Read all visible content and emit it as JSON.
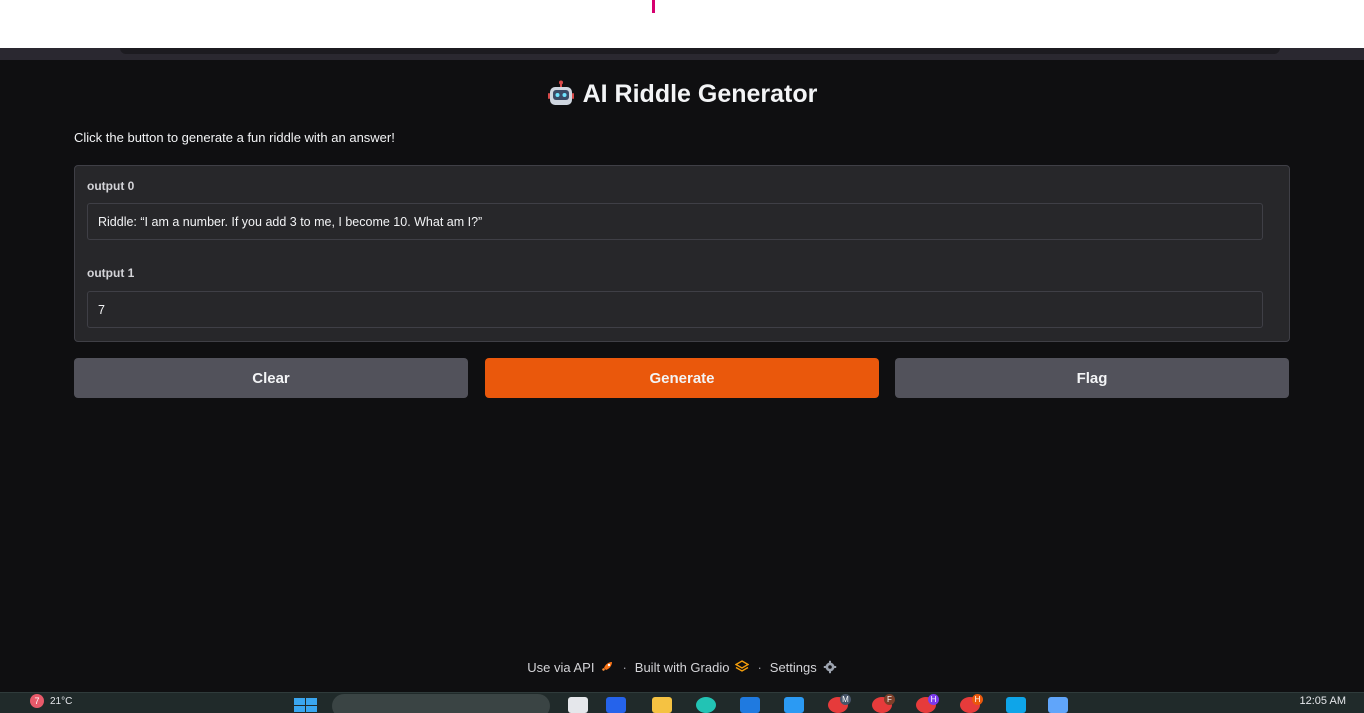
{
  "app": {
    "title": "AI Riddle Generator",
    "description": "Click the button to generate a fun riddle with an answer!"
  },
  "outputs": [
    {
      "label": "output 0",
      "value": "Riddle: “I am a number. If you add 3 to me, I become 10. What am I?”"
    },
    {
      "label": "output 1",
      "value": "7"
    }
  ],
  "buttons": {
    "clear": "Clear",
    "generate": "Generate",
    "flag": "Flag"
  },
  "footer": {
    "api": "Use via API",
    "built": "Built with Gradio",
    "settings": "Settings",
    "separator": "·"
  },
  "taskbar": {
    "weather_badge": "7",
    "temperature": "21°C",
    "clock": "12:05 AM",
    "app_badges": [
      "M",
      "F",
      "H",
      "H"
    ]
  },
  "colors": {
    "primary": "#ea580c",
    "secondary": "#52525b",
    "background": "#0f0f11"
  }
}
